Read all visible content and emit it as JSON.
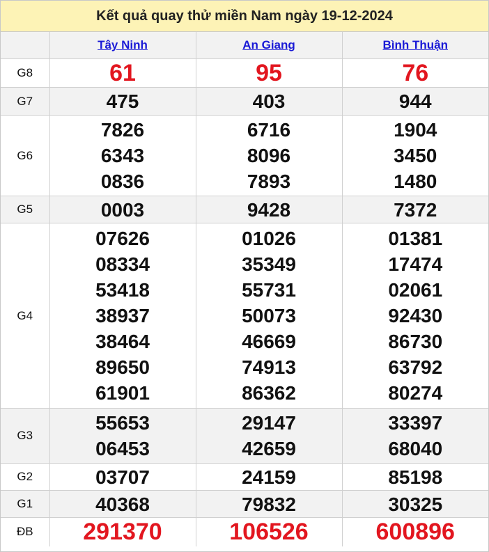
{
  "title": "Kết quả quay thử miền Nam ngày 19-12-2024",
  "provinces": [
    "Tây Ninh",
    "An Giang",
    "Bình Thuận"
  ],
  "prizes": [
    {
      "label": "G8",
      "values": [
        [
          "61"
        ],
        [
          "95"
        ],
        [
          "76"
        ]
      ]
    },
    {
      "label": "G7",
      "values": [
        [
          "475"
        ],
        [
          "403"
        ],
        [
          "944"
        ]
      ]
    },
    {
      "label": "G6",
      "values": [
        [
          "7826",
          "6343",
          "0836"
        ],
        [
          "6716",
          "8096",
          "7893"
        ],
        [
          "1904",
          "3450",
          "1480"
        ]
      ]
    },
    {
      "label": "G5",
      "values": [
        [
          "0003"
        ],
        [
          "9428"
        ],
        [
          "7372"
        ]
      ]
    },
    {
      "label": "G4",
      "values": [
        [
          "07626",
          "08334",
          "53418",
          "38937",
          "38464",
          "89650",
          "61901"
        ],
        [
          "01026",
          "35349",
          "55731",
          "50073",
          "46669",
          "74913",
          "86362"
        ],
        [
          "01381",
          "17474",
          "02061",
          "92430",
          "86730",
          "63792",
          "80274"
        ]
      ]
    },
    {
      "label": "G3",
      "values": [
        [
          "55653",
          "06453"
        ],
        [
          "29147",
          "42659"
        ],
        [
          "33397",
          "68040"
        ]
      ]
    },
    {
      "label": "G2",
      "values": [
        [
          "03707"
        ],
        [
          "24159"
        ],
        [
          "85198"
        ]
      ]
    },
    {
      "label": "G1",
      "values": [
        [
          "40368"
        ],
        [
          "79832"
        ],
        [
          "30325"
        ]
      ]
    },
    {
      "label": "ĐB",
      "values": [
        [
          "291370"
        ],
        [
          "106526"
        ],
        [
          "600896"
        ]
      ]
    }
  ],
  "colors": {
    "title_bg": "#fdf3b6",
    "highlight_red": "#e2161f",
    "province_link": "#1a1ad6",
    "shaded_row": "#f2f2f2"
  }
}
